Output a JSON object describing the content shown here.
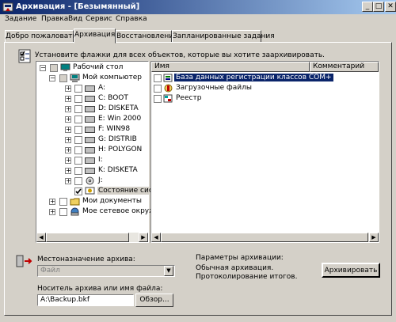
{
  "window": {
    "title": "Архивация - [Безымянный]",
    "min_glyph": "_",
    "max_glyph": "□",
    "close_glyph": "✕"
  },
  "menu": [
    "Задание",
    "Правка",
    "Вид",
    "Сервис",
    "Справка"
  ],
  "tabs": [
    "Добро пожаловать!",
    "Архивация",
    "Восстановление",
    "Запланированные задания"
  ],
  "instruction": "Установите флажки для всех объектов, которые вы хотите заархивировать.",
  "tree": {
    "root": "Рабочий стол",
    "computer": "Мой компьютер",
    "drives": [
      "A:",
      "C: BOOT",
      "D: DISKETA",
      "E: Win 2000",
      "F: WIN98",
      "G: DISTRIB",
      "H: POLYGON",
      "I:",
      "K: DISKETA",
      "J:"
    ],
    "system_state": "Состояние систе",
    "my_documents": "Мои документы",
    "network": "Мое сетевое окруже"
  },
  "list": {
    "columns": [
      "Имя",
      "Комментарий"
    ],
    "items": [
      "База данных регистрации классов COM+",
      "Загрузочные файлы",
      "Реестр"
    ]
  },
  "destination": {
    "label": "Местоназначение архива:",
    "value": "Файл"
  },
  "media": {
    "label": "Носитель архива или имя файла:",
    "value": "A:\\Backup.bkf",
    "browse": "Обзор..."
  },
  "params": {
    "title": "Параметры архивации:",
    "line1": "Обычная архивация.",
    "line2": "Протоколирование итогов."
  },
  "archive_button": "Архивировать",
  "colors": {
    "title_start": "#0a246a",
    "title_end": "#a6caf0",
    "selection": "#0a246a",
    "face": "#d4d0c8"
  }
}
